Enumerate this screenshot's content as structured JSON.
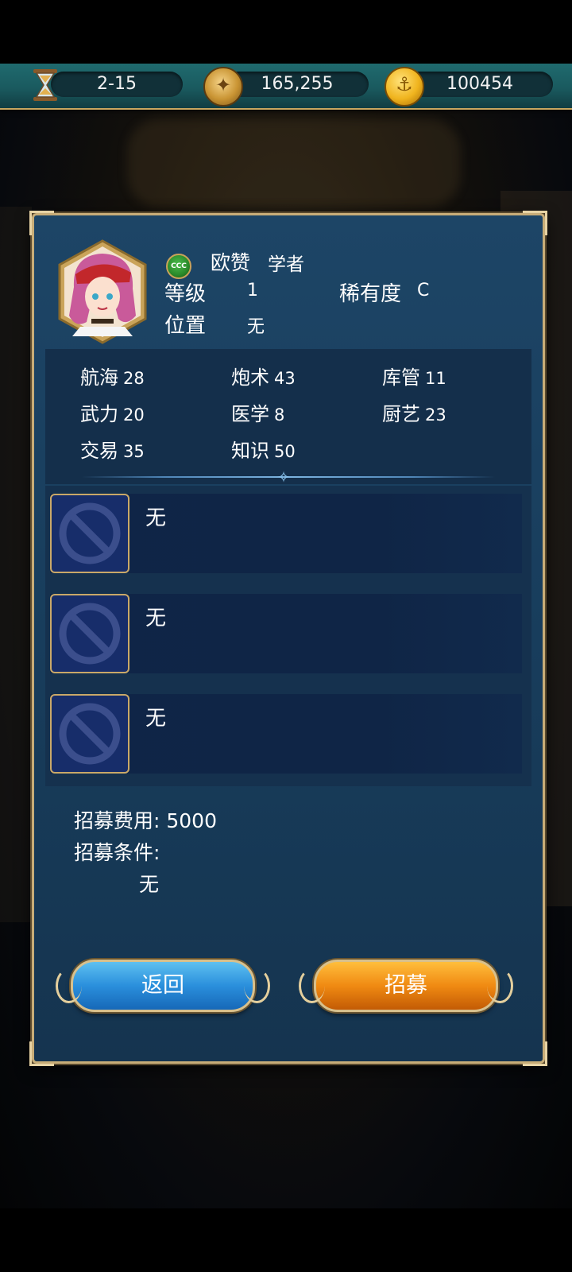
{
  "topbar": {
    "stage": "2-15",
    "compass_value": "165,255",
    "gold_value": "100454"
  },
  "officer": {
    "rank_badge": "CCC",
    "name": "欧赞",
    "profession": "学者",
    "level_label": "等级",
    "level_value": "1",
    "rarity_label": "稀有度",
    "rarity_value": "C",
    "position_label": "位置",
    "position_value": "无"
  },
  "stats": [
    {
      "label": "航海",
      "value": "28"
    },
    {
      "label": "炮术",
      "value": "43"
    },
    {
      "label": "库管",
      "value": "11"
    },
    {
      "label": "武力",
      "value": "20"
    },
    {
      "label": "医学",
      "value": "8"
    },
    {
      "label": "厨艺",
      "value": "23"
    },
    {
      "label": "交易",
      "value": "35"
    },
    {
      "label": "知识",
      "value": "50"
    }
  ],
  "skills": [
    {
      "name": "无"
    },
    {
      "name": "无"
    },
    {
      "name": "无"
    }
  ],
  "recruit": {
    "cost_text": "招募费用: 5000",
    "condition_label": "招募条件:",
    "condition_value": "无"
  },
  "buttons": {
    "back": "返回",
    "recruit": "招募"
  },
  "colors": {
    "panel_bg": "#1a4162",
    "border_gold": "#c8ad78",
    "back_button": "#2a8fdc",
    "recruit_button": "#f08a12"
  }
}
